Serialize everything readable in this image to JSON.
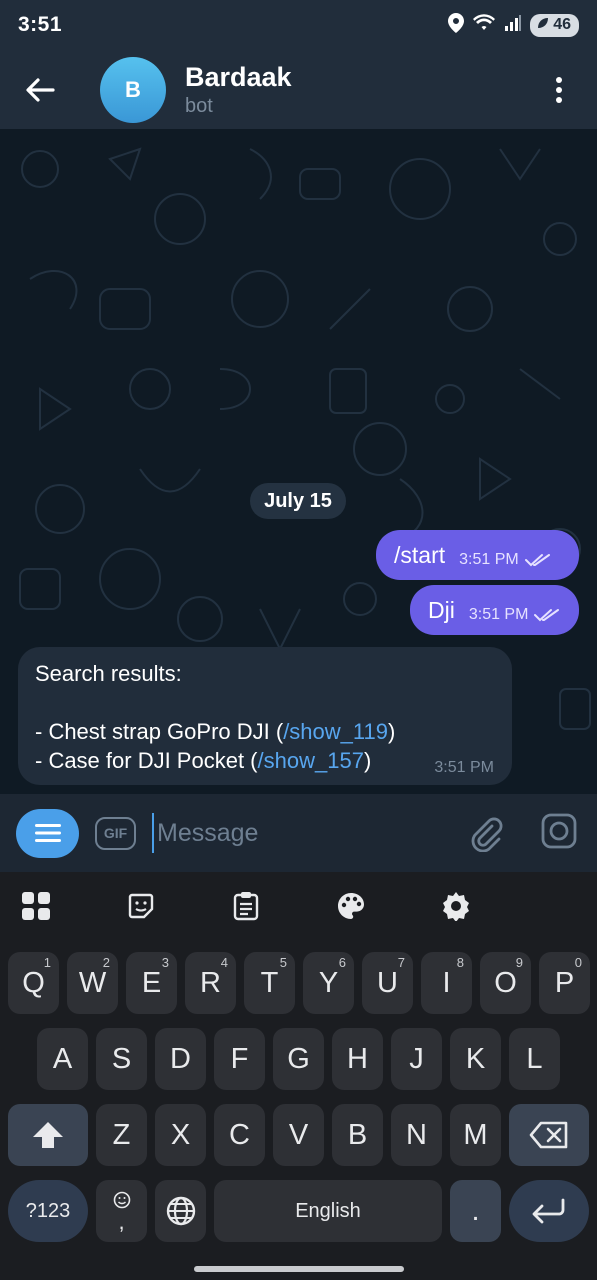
{
  "status_bar": {
    "time": "3:51",
    "battery": "46"
  },
  "header": {
    "avatar_letter": "B",
    "title": "Bardaak",
    "subtitle": "bot"
  },
  "chat": {
    "date_chip": "July 15",
    "outgoing": [
      {
        "text": "/start",
        "time": "3:51 PM"
      },
      {
        "text": "Dji",
        "time": "3:51 PM"
      }
    ],
    "incoming": {
      "line1": "Search results:",
      "item1_text": "- Chest strap GoPro DJI (",
      "item1_link": "/show_119",
      "item1_close": ")",
      "item2_text": "- Case for DJI Pocket (",
      "item2_link": "/show_157",
      "item2_close": ")",
      "time": "3:51 PM"
    }
  },
  "composer": {
    "gif_label": "GIF",
    "placeholder": "Message"
  },
  "keyboard": {
    "row1": [
      {
        "key": "Q",
        "sup": "1"
      },
      {
        "key": "W",
        "sup": "2"
      },
      {
        "key": "E",
        "sup": "3"
      },
      {
        "key": "R",
        "sup": "4"
      },
      {
        "key": "T",
        "sup": "5"
      },
      {
        "key": "Y",
        "sup": "6"
      },
      {
        "key": "U",
        "sup": "7"
      },
      {
        "key": "I",
        "sup": "8"
      },
      {
        "key": "O",
        "sup": "9"
      },
      {
        "key": "P",
        "sup": "0"
      }
    ],
    "row2": [
      "A",
      "S",
      "D",
      "F",
      "G",
      "H",
      "J",
      "K",
      "L"
    ],
    "row3": [
      "Z",
      "X",
      "C",
      "V",
      "B",
      "N",
      "M"
    ],
    "sym_label": "?123",
    "comma": ",",
    "space_label": "English",
    "period": "."
  },
  "colors": {
    "accent": "#4a9fe9",
    "outgoing_bubble": "#6a5ee6",
    "incoming_bubble": "#212d3b",
    "link": "#58a6ef"
  }
}
